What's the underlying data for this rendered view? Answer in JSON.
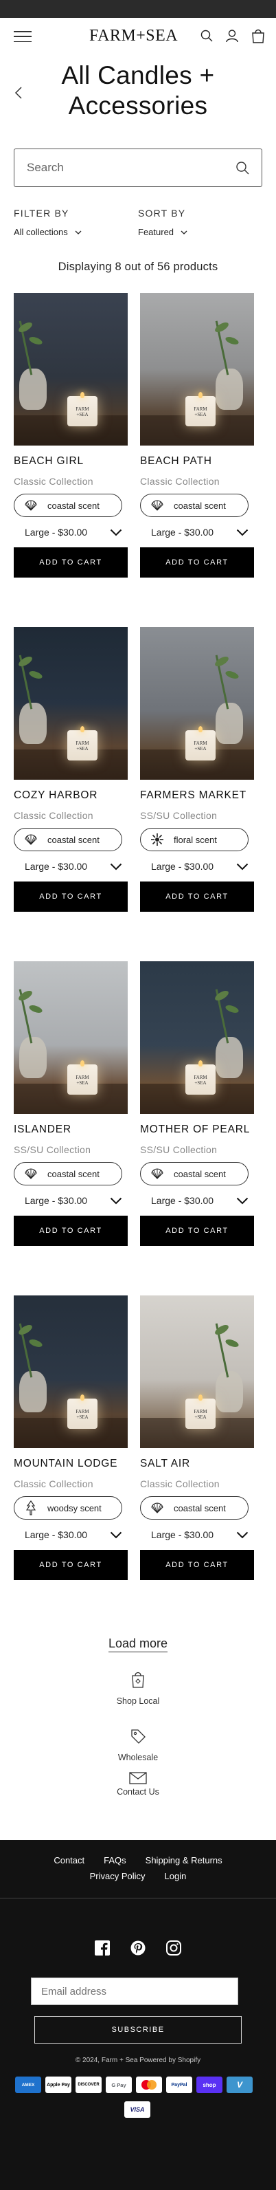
{
  "header": {
    "logo": "FARM+SEA"
  },
  "page": {
    "title": "All Candles + Accessories"
  },
  "search": {
    "placeholder": "Search"
  },
  "filters": {
    "filter_label": "FILTER BY",
    "filter_value": "All collections",
    "sort_label": "SORT BY",
    "sort_value": "Featured"
  },
  "product_count": "Displaying 8 out of 56 products",
  "products": [
    {
      "name": "BEACH GIRL",
      "collection": "Classic Collection",
      "scent": "coastal scent",
      "scent_icon": "shell-icon",
      "price": "Large - $30.00",
      "button": "ADD TO CART"
    },
    {
      "name": "BEACH PATH",
      "collection": "Classic Collection",
      "scent": "coastal scent",
      "scent_icon": "shell-icon",
      "price": "Large - $30.00",
      "button": "ADD TO CART"
    },
    {
      "name": "COZY HARBOR",
      "collection": "Classic Collection",
      "scent": "coastal scent",
      "scent_icon": "shell-icon",
      "price": "Large - $30.00",
      "button": "ADD TO CART"
    },
    {
      "name": "FARMERS MARKET",
      "collection": "SS/SU Collection",
      "scent": "floral scent",
      "scent_icon": "flower-icon",
      "price": "Large - $30.00",
      "button": "ADD TO CART"
    },
    {
      "name": "ISLANDER",
      "collection": "SS/SU Collection",
      "scent": "coastal scent",
      "scent_icon": "shell-icon",
      "price": "Large - $30.00",
      "button": "ADD TO CART"
    },
    {
      "name": "MOTHER OF  PEARL",
      "collection": "SS/SU Collection",
      "scent": "coastal scent",
      "scent_icon": "shell-icon",
      "price": "Large - $30.00",
      "button": "ADD TO CART"
    },
    {
      "name": "MOUNTAIN LODGE",
      "collection": "Classic Collection",
      "scent": "woodsy scent",
      "scent_icon": "tree-icon",
      "price": "Large - $30.00",
      "button": "ADD TO CART"
    },
    {
      "name": "SALT AIR",
      "collection": "Classic Collection",
      "scent": "coastal scent",
      "scent_icon": "shell-icon",
      "price": "Large - $30.00",
      "button": "ADD TO CART"
    }
  ],
  "load_more": "Load more",
  "info_links": [
    {
      "label": "Shop Local",
      "icon": "shopping-bag-icon"
    },
    {
      "label": "Wholesale",
      "icon": "tag-icon"
    },
    {
      "label": "Contact Us",
      "icon": "envelope-icon"
    }
  ],
  "footer": {
    "links": [
      "Contact",
      "FAQs",
      "Shipping & Returns",
      "Privacy Policy",
      "Login"
    ],
    "social": [
      "facebook-icon",
      "pinterest-icon",
      "instagram-icon"
    ],
    "email_placeholder": "Email address",
    "subscribe": "SUBSCRIBE",
    "copyright": "© 2024, Farm + Sea Powered by Shopify",
    "payments": [
      "AMEX",
      "Apple Pay",
      "DISCOVER",
      "G Pay",
      "Mastercard",
      "PayPal",
      "shop",
      "V",
      "VISA"
    ]
  },
  "colors": {
    "topbar": "#2b2b2b",
    "button_bg": "#000000",
    "footer_bg": "#121212",
    "muted_text": "#888888"
  }
}
